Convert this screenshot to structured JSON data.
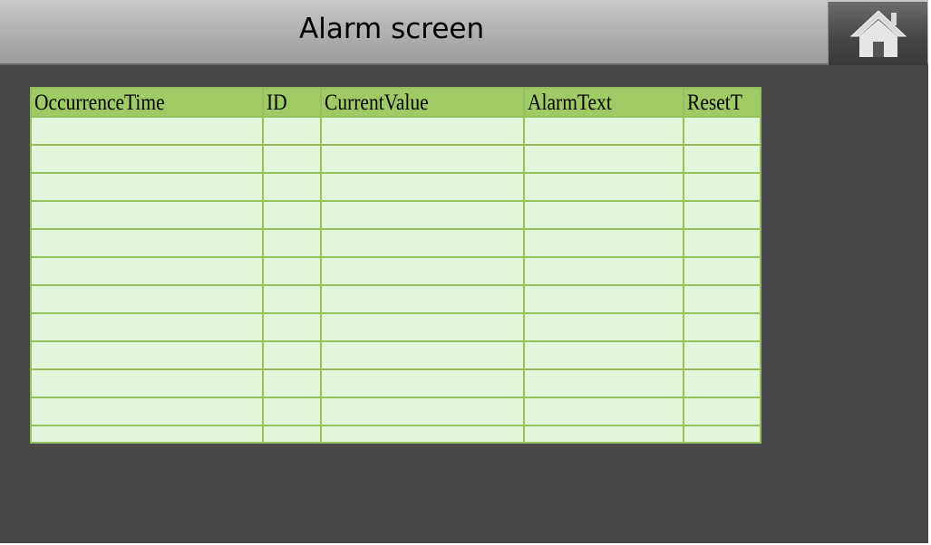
{
  "header": {
    "title": "Alarm screen",
    "home_icon": "home-icon"
  },
  "colors": {
    "background": "#474747",
    "header": "#b3b3b3",
    "table_header": "#9ecb63",
    "table_cell": "#e4f6da",
    "grid_line": "#96c05e"
  },
  "alarm_table": {
    "columns": [
      "OccurrenceTime",
      "ID",
      "CurrentValue",
      "AlarmText",
      "ResetT"
    ],
    "rows": [
      [
        "",
        "",
        "",
        "",
        ""
      ],
      [
        "",
        "",
        "",
        "",
        ""
      ],
      [
        "",
        "",
        "",
        "",
        ""
      ],
      [
        "",
        "",
        "",
        "",
        ""
      ],
      [
        "",
        "",
        "",
        "",
        ""
      ],
      [
        "",
        "",
        "",
        "",
        ""
      ],
      [
        "",
        "",
        "",
        "",
        ""
      ],
      [
        "",
        "",
        "",
        "",
        ""
      ],
      [
        "",
        "",
        "",
        "",
        ""
      ],
      [
        "",
        "",
        "",
        "",
        ""
      ],
      [
        "",
        "",
        "",
        "",
        ""
      ],
      [
        "",
        "",
        "",
        "",
        ""
      ]
    ]
  }
}
